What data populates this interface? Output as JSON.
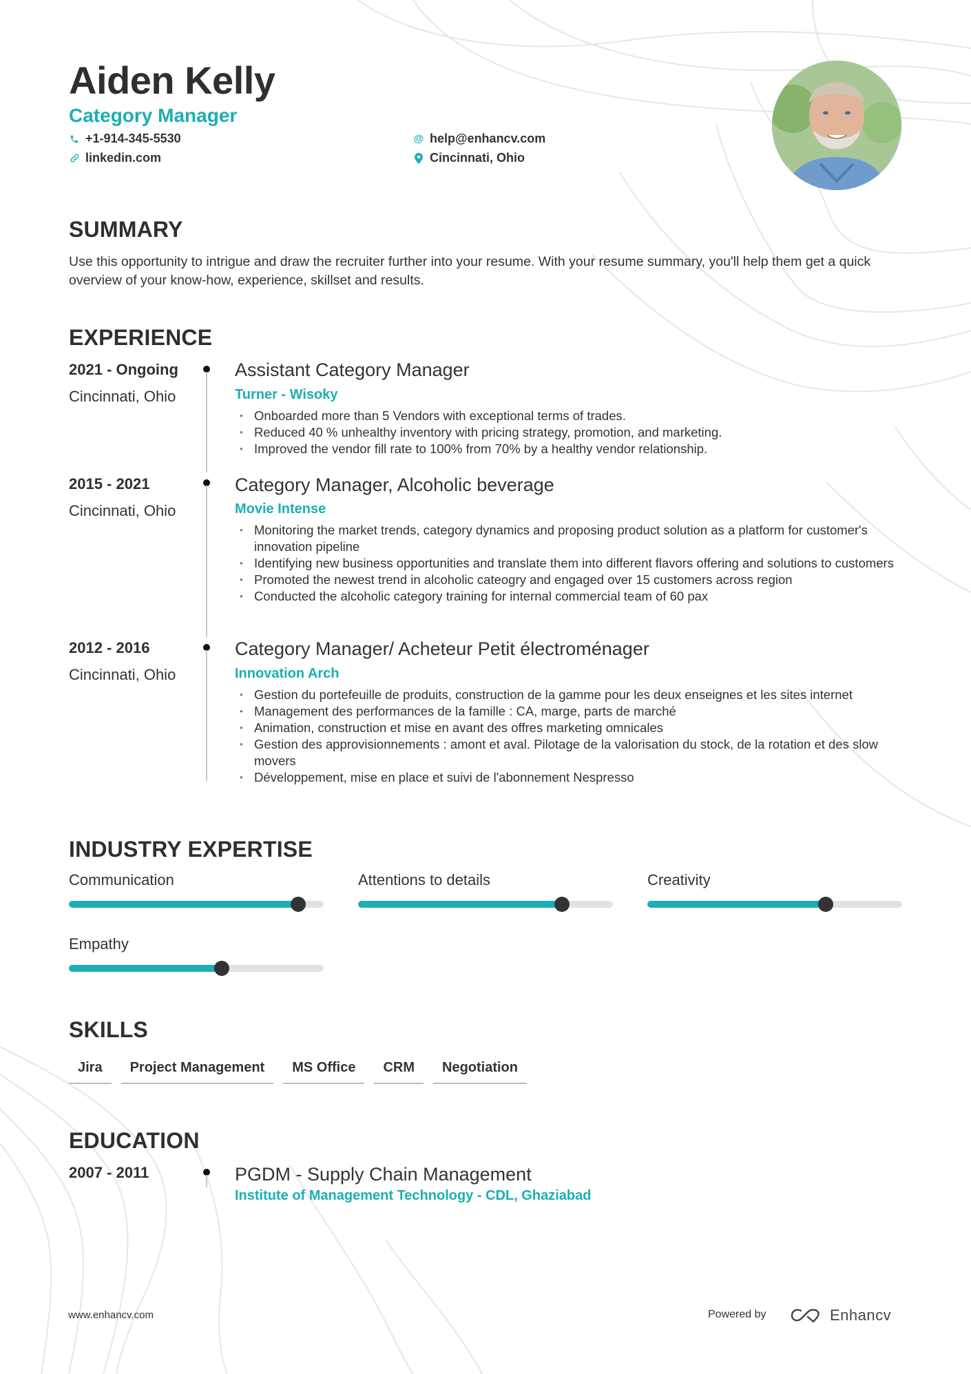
{
  "header": {
    "name": "Aiden Kelly",
    "role": "Category Manager",
    "contacts": {
      "phone": {
        "icon": "phone-icon",
        "value": "+1-914-345-5530"
      },
      "email": {
        "icon": "at-icon",
        "value": "help@enhancv.com"
      },
      "link": {
        "icon": "link-icon",
        "value": "linkedin.com"
      },
      "location": {
        "icon": "map-pin-icon",
        "value": "Cincinnati, Ohio"
      }
    },
    "photo_alt": "Profile photo"
  },
  "summary": {
    "title": "SUMMARY",
    "text": "Use this opportunity to intrigue and draw the recruiter further into your resume. With your resume summary, you'll help them get a quick overview of your know-how, experience, skillset and results."
  },
  "experience": {
    "title": "EXPERIENCE",
    "items": [
      {
        "dates": "2021 - Ongoing",
        "location": "Cincinnati, Ohio",
        "title": "Assistant Category Manager",
        "company": "Turner - Wisoky",
        "bullets": [
          "Onboarded more than 5 Vendors with exceptional terms of trades.",
          "Reduced 40 % unhealthy inventory with pricing strategy, promotion, and marketing.",
          "Improved the vendor fill rate to 100% from 70% by a healthy vendor relationship."
        ]
      },
      {
        "dates": "2015 - 2021",
        "location": "Cincinnati, Ohio",
        "title": "Category Manager, Alcoholic beverage",
        "company": "Movie Intense",
        "bullets": [
          "Monitoring the market trends, category dynamics and proposing product solution as a platform for customer's innovation pipeline",
          "Identifying new business opportunities and translate them into different flavors offering and solutions to customers",
          "Promoted  the newest trend in alcoholic cateogry and engaged over 15 customers across region",
          "Conducted the alcoholic category training for internal commercial team of 60 pax"
        ]
      },
      {
        "dates": "2012 - 2016",
        "location": "Cincinnati, Ohio",
        "title": "Category Manager/ Acheteur Petit électroménager",
        "company": "Innovation Arch",
        "bullets": [
          "Gestion du portefeuille de produits, construction de la gamme pour les deux enseignes et les sites internet",
          "Management des performances de la famille : CA, marge, parts de marché",
          "Animation, construction et mise en avant des offres marketing omnicales",
          "Gestion des approvisionnements : amont et aval. Pilotage de la valorisation du stock, de la rotation et des slow movers",
          "Développement, mise en place et suivi de l'abonnement Nespresso"
        ]
      }
    ]
  },
  "expertise": {
    "title": "INDUSTRY EXPERTISE",
    "items": [
      {
        "label": "Communication",
        "level_percent": 90
      },
      {
        "label": "Attentions to details",
        "level_percent": 80
      },
      {
        "label": "Creativity",
        "level_percent": 70
      },
      {
        "label": "Empathy",
        "level_percent": 60
      }
    ]
  },
  "skills": {
    "title": "SKILLS",
    "items": [
      "Jira",
      "Project Management",
      "MS Office",
      "CRM",
      "Negotiation"
    ]
  },
  "education": {
    "title": "EDUCATION",
    "items": [
      {
        "dates": "2007 - 2011",
        "degree": "PGDM - Supply Chain Management",
        "school": "Institute of Management Technology - CDL, Ghaziabad"
      }
    ]
  },
  "footer": {
    "url": "www.enhancv.com",
    "powered_by": "Powered by",
    "brand": "Enhancv"
  },
  "colors": {
    "accent": "#1aafb4",
    "text": "#333333",
    "heading": "#2f2f2f",
    "bar_track": "#e2e2e2",
    "knob": "#333333"
  }
}
